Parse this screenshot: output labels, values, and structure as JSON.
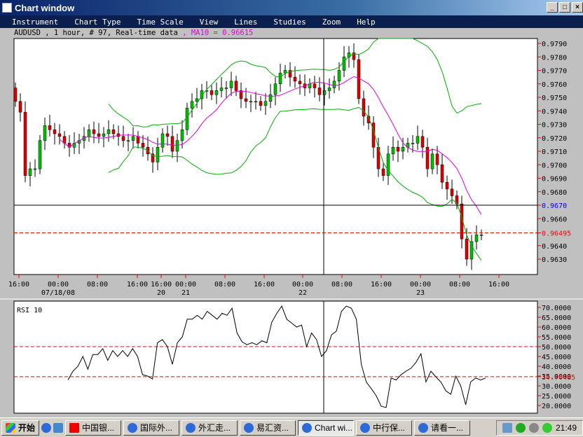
{
  "window": {
    "title": "Chart window"
  },
  "menu": [
    "Instrument",
    "Chart Type",
    "Time Scale",
    "View",
    "Lines",
    "Studies",
    "Zoom",
    "Help"
  ],
  "info": {
    "text": "AUDUSD , 1 hour, # 97, Real-time data ",
    "ma": ", MA10 = 0.96615"
  },
  "colors": {
    "up": "#00c000",
    "down": "#e00000",
    "ma": "#e000e0",
    "bands": "#00b000",
    "crosshair_label": "#0000ff",
    "alert_line": "#ff0000"
  },
  "price_axis": {
    "labels": [
      "0.9790",
      "0.9780",
      "0.9770",
      "0.9760",
      "0.9750",
      "0.9740",
      "0.9730",
      "0.9720",
      "0.9710",
      "0.9700",
      "0.9690",
      "0.9680",
      "0.9670",
      "0.9660",
      "0.96495",
      "0.9640",
      "0.9630"
    ],
    "crosshair_price": "0.9670",
    "alert_price": "0.96495"
  },
  "time_axis": [
    [
      "16:00",
      ""
    ],
    [
      "00:00",
      "07/18/08"
    ],
    [
      "08:00",
      ""
    ],
    [
      "16:00",
      ""
    ],
    [
      "16:00",
      "20"
    ],
    [
      "00:00",
      "21"
    ],
    [
      "08:00",
      ""
    ],
    [
      "16:00",
      ""
    ],
    [
      "00:00",
      "22"
    ],
    [
      "08:00",
      ""
    ],
    [
      "16:00",
      ""
    ],
    [
      "00:00",
      "23"
    ],
    [
      "08:00",
      ""
    ],
    [
      "16:00",
      ""
    ]
  ],
  "closes": [
    0.9747,
    0.9739,
    0.9692,
    0.9697,
    0.9697,
    0.9718,
    0.9729,
    0.9726,
    0.9723,
    0.9721,
    0.9716,
    0.9713,
    0.9716,
    0.9718,
    0.9721,
    0.9726,
    0.9723,
    0.9721,
    0.9723,
    0.9726,
    0.9723,
    0.9721,
    0.9718,
    0.9718,
    0.9721,
    0.9716,
    0.9713,
    0.9708,
    0.9702,
    0.9713,
    0.9723,
    0.9721,
    0.971,
    0.9718,
    0.9726,
    0.9742,
    0.9747,
    0.9749,
    0.9755,
    0.9755,
    0.9752,
    0.9755,
    0.9757,
    0.9757,
    0.9762,
    0.9755,
    0.9749,
    0.9747,
    0.9747,
    0.9747,
    0.9744,
    0.9747,
    0.9752,
    0.976,
    0.9768,
    0.977,
    0.9765,
    0.9762,
    0.976,
    0.9757,
    0.976,
    0.9757,
    0.9752,
    0.9755,
    0.9757,
    0.9762,
    0.977,
    0.978,
    0.9783,
    0.9778,
    0.9749,
    0.9736,
    0.9731,
    0.9713,
    0.9697,
    0.9692,
    0.9708,
    0.9713,
    0.971,
    0.9713,
    0.9716,
    0.9716,
    0.9721,
    0.9713,
    0.9697,
    0.9708,
    0.97,
    0.9687,
    0.9682,
    0.9677,
    0.9671,
    0.9645,
    0.963,
    0.9643,
    0.9648,
    0.9648
  ],
  "rsi": {
    "title": "RSI 10",
    "labels": [
      "70.0000",
      "65.0000",
      "60.0000",
      "55.0000",
      "50.0000",
      "45.0000",
      "40.0000",
      "35.0000",
      "34.70485",
      "30.0000",
      "25.0000",
      "20.0000"
    ],
    "level_high": 50,
    "level_low": 34.70485,
    "values": [
      33,
      37.5,
      40,
      45,
      38.5,
      46,
      46,
      49,
      43,
      48,
      45,
      48,
      45,
      49,
      45,
      35.7,
      35,
      33.5,
      52,
      53.6,
      50,
      41,
      52,
      55,
      64,
      64,
      66,
      64,
      68,
      66,
      64,
      67,
      66,
      69.6,
      57,
      52.5,
      51,
      52,
      51,
      53,
      52,
      62.5,
      67,
      70.7,
      64,
      62,
      60,
      61,
      50,
      57,
      53.6,
      45,
      48,
      56,
      58,
      68,
      70.7,
      69.6,
      64,
      41,
      32,
      28.6,
      25,
      19.6,
      19,
      34,
      33,
      35.7,
      37.5,
      39,
      42,
      46.4,
      32,
      37.5,
      34.6,
      32,
      27.5,
      25.7,
      35,
      30,
      20.4,
      32,
      34,
      33,
      34
    ]
  },
  "taskbar": {
    "start": "开始",
    "items": [
      "中国银...",
      "国际外...",
      "外汇走...",
      "易汇资...",
      "Chart wi...",
      "中行保...",
      "请看一..."
    ],
    "active": 4,
    "clock": "21:49"
  }
}
